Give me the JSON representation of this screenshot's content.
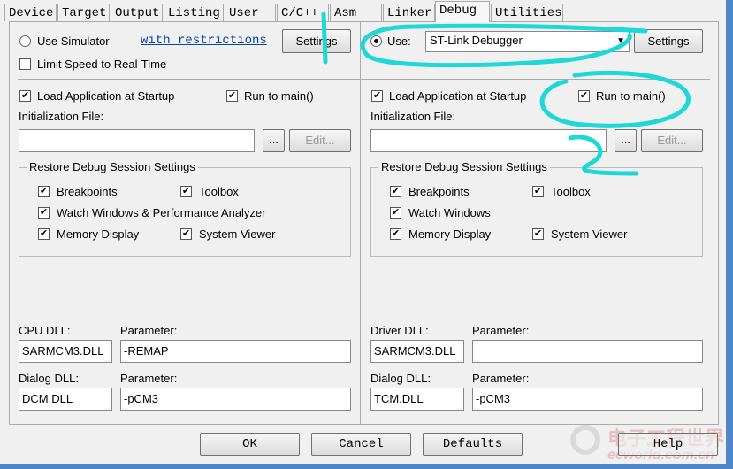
{
  "tabs": [
    "Device",
    "Target",
    "Output",
    "Listing",
    "User",
    "C/C++",
    "Asm",
    "Linker",
    "Debug",
    "Utilities"
  ],
  "active_tab": "Debug",
  "left": {
    "use_simulator": "Use Simulator",
    "simulator_selected": false,
    "restrictions_link": "with restrictions",
    "settings": "Settings",
    "limit_speed": "Limit Speed to Real-Time",
    "limit_speed_checked": false,
    "load_app": "Load Application at Startup",
    "load_app_checked": true,
    "run_to_main": "Run to main()",
    "run_to_main_checked": true,
    "init_file_label": "Initialization File:",
    "init_file_value": "",
    "browse": "...",
    "edit": "Edit...",
    "restore_group": "Restore Debug Session Settings",
    "breakpoints": "Breakpoints",
    "toolbox": "Toolbox",
    "watch": "Watch Windows & Performance Analyzer",
    "memory": "Memory Display",
    "system_viewer": "System Viewer",
    "cpu_dll_label": "CPU DLL:",
    "cpu_dll": "SARMCM3.DLL",
    "param_label": "Parameter:",
    "cpu_param": "-REMAP",
    "dialog_dll_label": "Dialog DLL:",
    "dialog_dll": "DCM.DLL",
    "dialog_param": "-pCM3"
  },
  "right": {
    "use": "Use:",
    "use_selected": true,
    "debugger": "ST-Link Debugger",
    "settings": "Settings",
    "load_app": "Load Application at Startup",
    "load_app_checked": true,
    "run_to_main": "Run to main()",
    "run_to_main_checked": true,
    "init_file_label": "Initialization File:",
    "init_file_value": "",
    "browse": "...",
    "edit": "Edit...",
    "restore_group": "Restore Debug Session Settings",
    "breakpoints": "Breakpoints",
    "toolbox": "Toolbox",
    "watch": "Watch Windows",
    "memory": "Memory Display",
    "system_viewer": "System Viewer",
    "driver_dll_label": "Driver DLL:",
    "driver_dll": "SARMCM3.DLL",
    "param_label": "Parameter:",
    "driver_param": "",
    "dialog_dll_label": "Dialog DLL:",
    "dialog_dll": "TCM.DLL",
    "dialog_param": "-pCM3"
  },
  "buttons": {
    "ok": "OK",
    "cancel": "Cancel",
    "defaults": "Defaults",
    "help": "Help"
  },
  "watermark": {
    "cn": "电子工程世界",
    "en": "eeworld.com.cn"
  },
  "annotation_color": "#1ed8d8"
}
